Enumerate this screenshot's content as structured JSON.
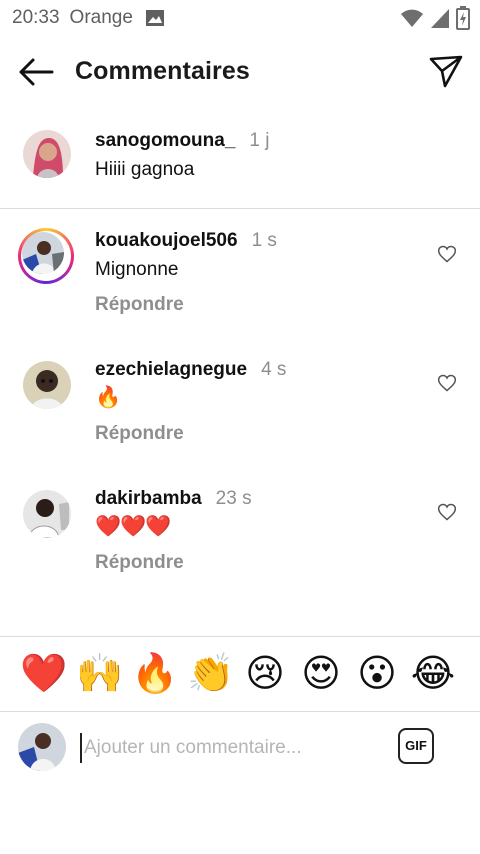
{
  "status_bar": {
    "time": "20:33",
    "carrier": "Orange"
  },
  "header": {
    "title": "Commentaires"
  },
  "caption": {
    "username": "sanogomouna_",
    "time": "1 j",
    "text": "Hiiii gagnoa"
  },
  "comments": [
    {
      "username": "kouakoujoel506",
      "time": "1 s",
      "text": "Mignonne",
      "reply_label": "Répondre"
    },
    {
      "username": "ezechielagnegue",
      "time": "4 s",
      "text": "🔥",
      "reply_label": "Répondre"
    },
    {
      "username": "dakirbamba",
      "time": "23 s",
      "text": "❤️❤️❤️",
      "reply_label": "Répondre"
    }
  ],
  "emoji_bar": [
    "❤️",
    "🙌",
    "🔥",
    "👏",
    "😢",
    "😍",
    "😮",
    "😂"
  ],
  "composer": {
    "placeholder": "Ajouter un commentaire...",
    "gif_label": "GIF"
  },
  "colors": {
    "text": "#111111",
    "muted": "#8e8e8e",
    "divider": "#dcdcdc"
  },
  "icons": [
    "image-icon",
    "wifi-icon",
    "signal-icon",
    "battery-icon",
    "back-arrow-icon",
    "send-icon",
    "heart-outline-icon"
  ]
}
